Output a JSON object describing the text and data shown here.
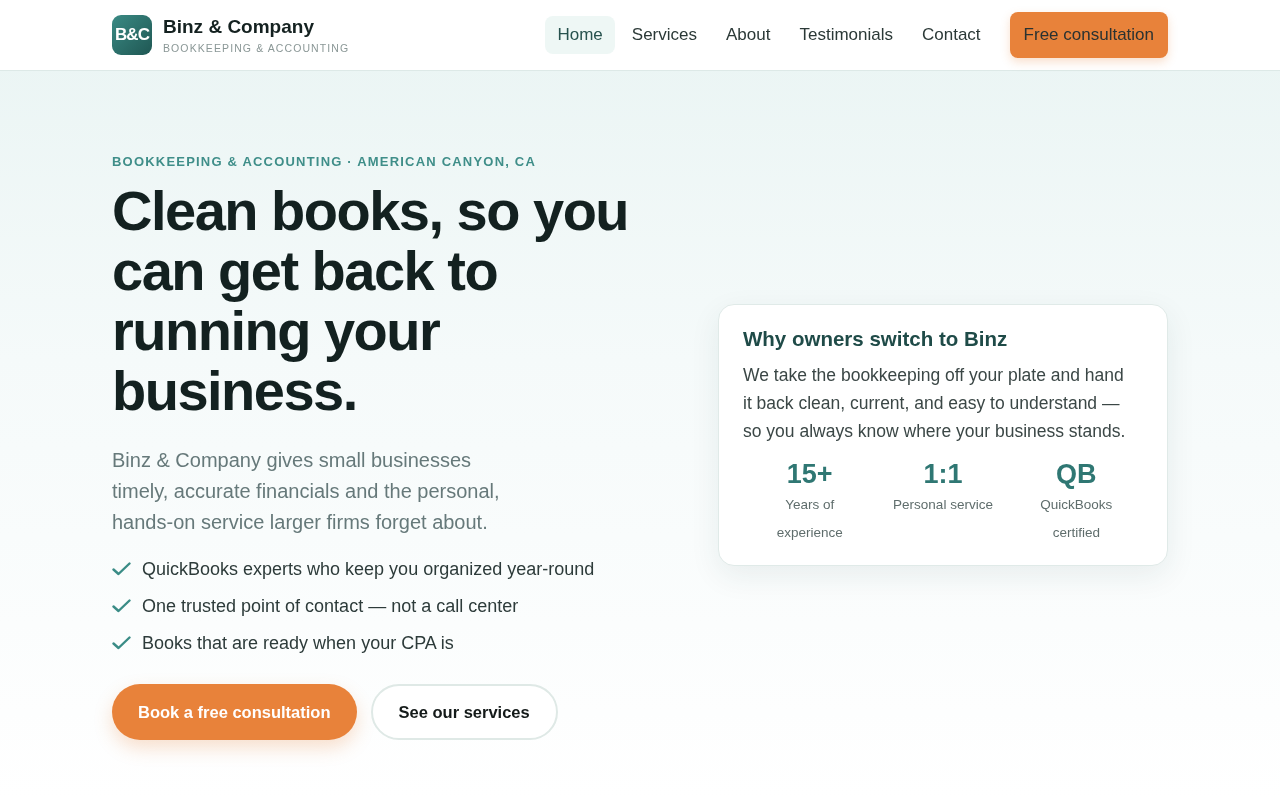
{
  "header": {
    "logo": {
      "mark": "B&C",
      "name": "Binz & Company",
      "tagline": "BOOKKEEPING & ACCOUNTING"
    },
    "nav": [
      {
        "label": "Home",
        "selected": true
      },
      {
        "label": "Services",
        "selected": false
      },
      {
        "label": "About",
        "selected": false
      },
      {
        "label": "Testimonials",
        "selected": false
      },
      {
        "label": "Contact",
        "selected": false
      }
    ],
    "cta": "Free consultation"
  },
  "hero": {
    "eyebrow": "BOOKKEEPING & ACCOUNTING · AMERICAN CANYON, CA",
    "headline": "Clean books, so you can get back to running your business.",
    "intro": "Binz & Company gives small businesses timely, accurate financials and the personal, hands-on service larger firms forget about.",
    "checklist": [
      "QuickBooks experts who keep you organized year-round",
      "One trusted point of contact — not a call center",
      "Books that are ready when your CPA is"
    ],
    "buttons": [
      {
        "label": "Book a free consultation",
        "kind": "primary"
      },
      {
        "label": "See our services",
        "kind": "secondary"
      }
    ]
  },
  "card": {
    "title": "Why owners switch to Binz",
    "body": "We take the bookkeeping off your plate and hand it back clean, current, and easy to understand — so you always know where your business stands.",
    "stats": [
      {
        "value": "15+",
        "label": "Years of experience"
      },
      {
        "value": "1:1",
        "label": "Personal service"
      },
      {
        "value": "QB",
        "label": "QuickBooks certified"
      }
    ]
  }
}
